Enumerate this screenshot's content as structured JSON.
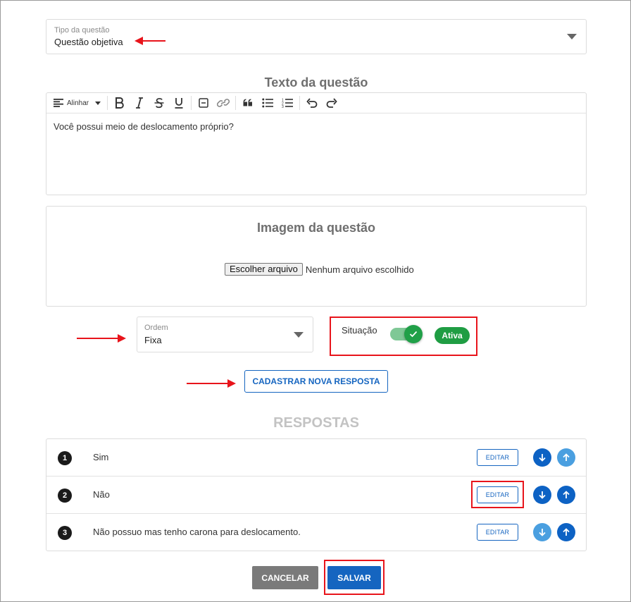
{
  "tipo_questao": {
    "label": "Tipo da questão",
    "value": "Questão objetiva"
  },
  "texto_questao": {
    "title": "Texto da questão",
    "toolbar": {
      "align_label": "Alinhar"
    },
    "content": "Você possui meio de deslocamento próprio?"
  },
  "imagem_questao": {
    "title": "Imagem da questão",
    "file_button": "Escolher arquivo",
    "file_status": "Nenhum arquivo escolhido"
  },
  "ordem": {
    "label": "Ordem",
    "value": "Fixa"
  },
  "situacao": {
    "label": "Situação",
    "toggle_on": true,
    "badge": "Ativa"
  },
  "cadastrar_button": "CADASTRAR NOVA RESPOSTA",
  "respostas": {
    "title": "RESPOSTAS",
    "edit_label": "EDITAR",
    "items": [
      {
        "number": "1",
        "text": "Sim"
      },
      {
        "number": "2",
        "text": "Não"
      },
      {
        "number": "3",
        "text": "Não possuo mas tenho carona para deslocamento."
      }
    ]
  },
  "actions": {
    "cancel": "CANCELAR",
    "save": "SALVAR"
  },
  "colors": {
    "primary": "#1565c0",
    "success": "#1f9d43",
    "cancel": "#7a7a7a",
    "annotation": "#e8141b"
  }
}
